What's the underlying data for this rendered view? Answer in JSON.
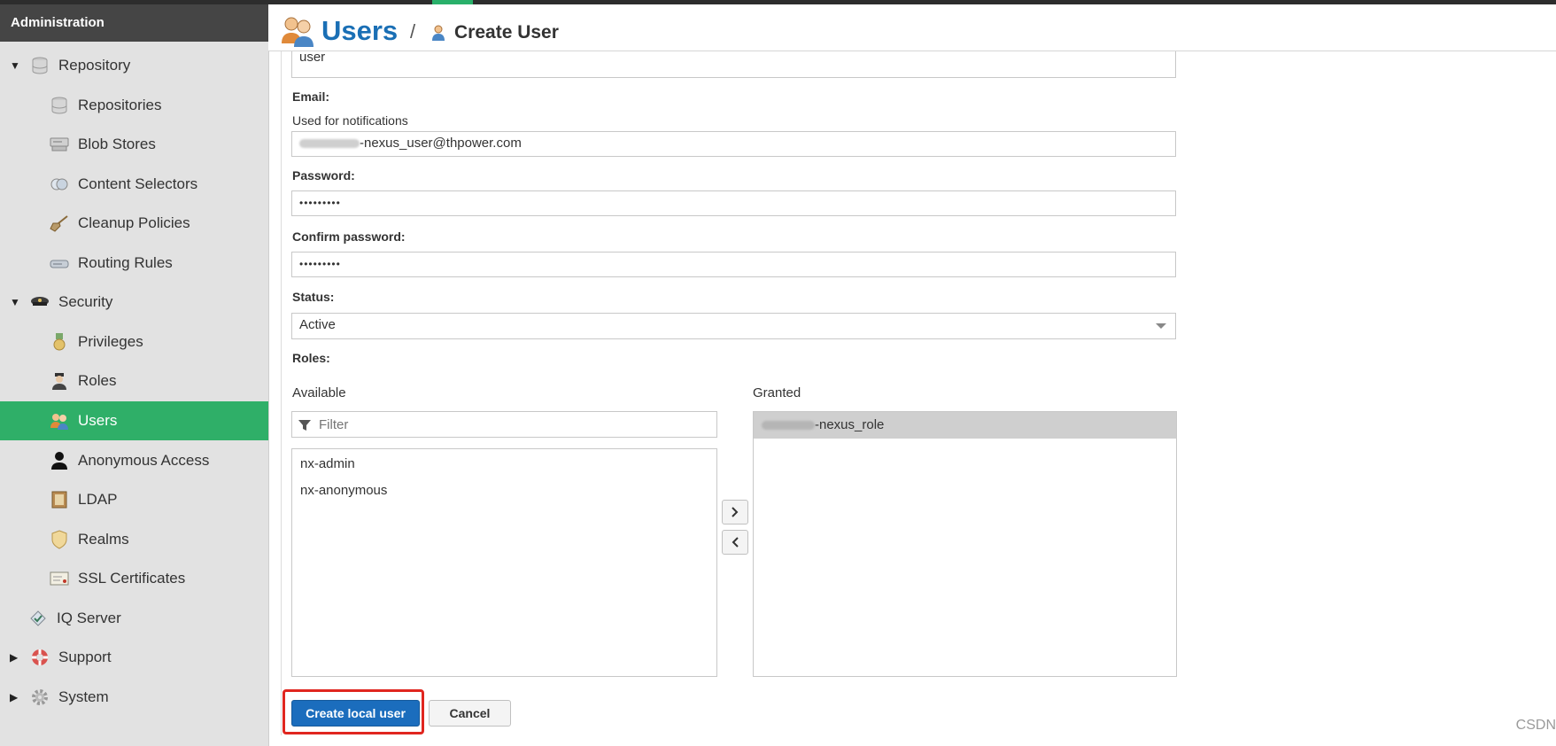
{
  "sidebar": {
    "header": "Administration",
    "items": {
      "repository": {
        "label": "Repository",
        "icon": "database-icon",
        "expanded": true
      },
      "repositories": {
        "label": "Repositories",
        "icon": "database-icon"
      },
      "blob_stores": {
        "label": "Blob Stores",
        "icon": "server-icon"
      },
      "content_selectors": {
        "label": "Content Selectors",
        "icon": "selector-icon"
      },
      "cleanup_policies": {
        "label": "Cleanup Policies",
        "icon": "broom-icon"
      },
      "routing_rules": {
        "label": "Routing Rules",
        "icon": "router-icon"
      },
      "security": {
        "label": "Security",
        "icon": "police-cap-icon",
        "expanded": true
      },
      "privileges": {
        "label": "Privileges",
        "icon": "medal-icon"
      },
      "roles": {
        "label": "Roles",
        "icon": "officer-icon"
      },
      "users": {
        "label": "Users",
        "icon": "users-icon",
        "active": true
      },
      "anonymous_access": {
        "label": "Anonymous Access",
        "icon": "person-icon"
      },
      "ldap": {
        "label": "LDAP",
        "icon": "book-icon"
      },
      "realms": {
        "label": "Realms",
        "icon": "shield-icon"
      },
      "ssl_certificates": {
        "label": "SSL Certificates",
        "icon": "certificate-icon"
      },
      "iq_server": {
        "label": "IQ Server",
        "icon": "iq-icon"
      },
      "support": {
        "label": "Support",
        "icon": "lifebuoy-icon",
        "expanded": false
      },
      "system": {
        "label": "System",
        "icon": "gear-icon",
        "expanded": false
      }
    }
  },
  "header": {
    "title": "Users",
    "separator": "/",
    "subtitle": "Create User"
  },
  "form": {
    "username_value": "user",
    "email_label": "Email:",
    "email_hint": "Used for notifications",
    "email_value": "-nexus_user@thpower.com",
    "password_label": "Password:",
    "password_value": "•••••••••",
    "confirm_label": "Confirm password:",
    "confirm_value": "•••••••••",
    "status_label": "Status:",
    "status_value": "Active",
    "roles_label": "Roles:",
    "available_label": "Available",
    "granted_label": "Granted",
    "filter_placeholder": "Filter",
    "available_roles": [
      "nx-admin",
      "nx-anonymous"
    ],
    "granted_roles": [
      "-nexus_role"
    ]
  },
  "buttons": {
    "create": "Create local user",
    "cancel": "Cancel"
  },
  "watermark": "CSDN",
  "colors": {
    "brand_blue": "#1a6fb5",
    "active_green": "#2faf68",
    "primary_button": "#1b6dbd",
    "highlight_red": "#e0261f"
  }
}
